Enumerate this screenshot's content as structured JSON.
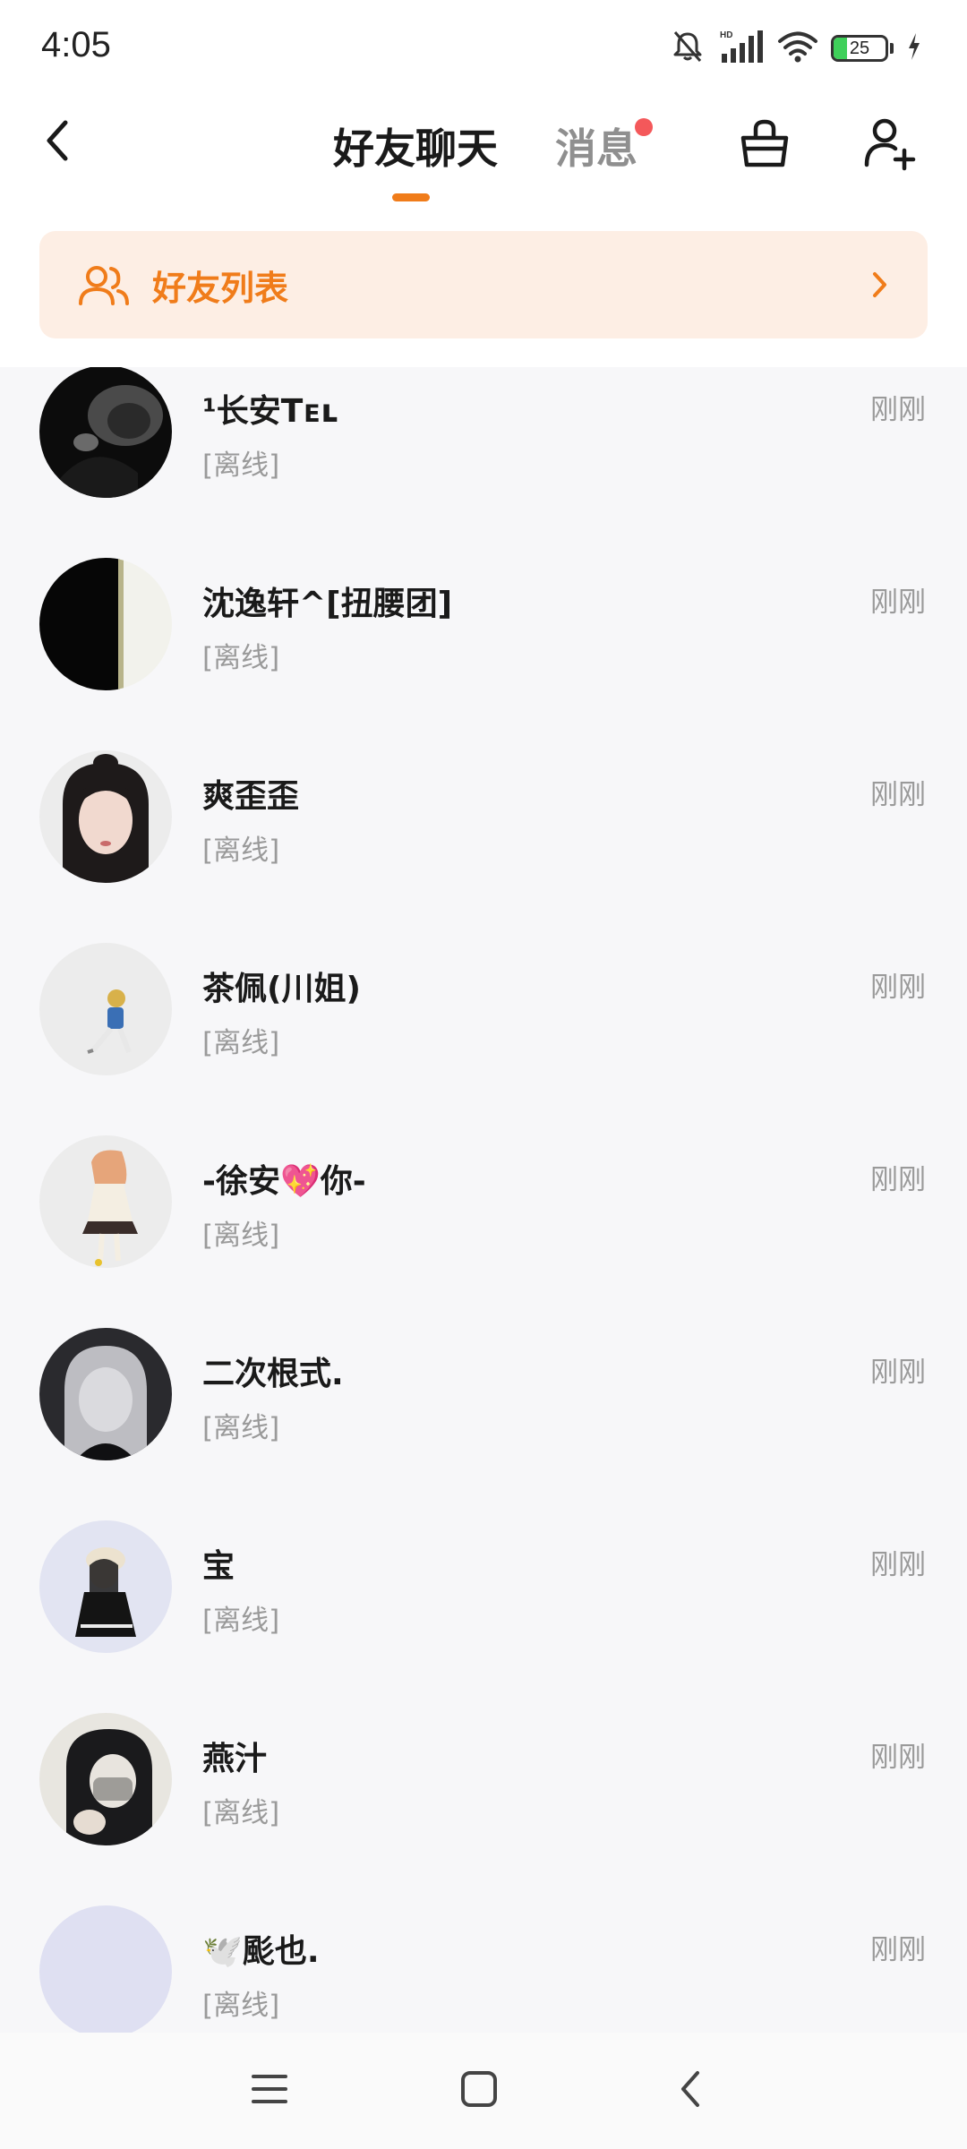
{
  "status_bar": {
    "time": "4:05",
    "battery_level": "25",
    "battery_fraction": 0.25,
    "icons": [
      "bell-mute-icon",
      "hd-icon",
      "signal-icon",
      "wifi-icon",
      "battery-icon",
      "charging-icon"
    ]
  },
  "header": {
    "back_icon": "chevron-left-icon",
    "tab_friends_chat": "好友聊天",
    "tab_messages": "消息",
    "messages_has_badge": true,
    "right_icons": [
      "basket-icon",
      "add-friend-icon"
    ]
  },
  "colors": {
    "accent": "#f07c1a",
    "banner_bg": "#fdeee4",
    "badge": "#f4585a",
    "list_bg": "#f7f7f9",
    "muted_text": "#9a9a9a"
  },
  "friends_banner": {
    "icon": "users-icon",
    "label": "好友列表",
    "chevron_icon": "chevron-right-icon"
  },
  "friends": [
    {
      "name": "¹长安Tᴇʟ",
      "status": "[离线]",
      "time": "刚刚"
    },
    {
      "name": "沈逸轩^[扭腰团]",
      "status": "[离线]",
      "time": "刚刚"
    },
    {
      "name": "爽歪歪",
      "status": "[离线]",
      "time": "刚刚"
    },
    {
      "name": "茶佩(川姐)",
      "status": "[离线]",
      "time": "刚刚"
    },
    {
      "name": "-徐安💖你-",
      "status": "[离线]",
      "time": "刚刚"
    },
    {
      "name": "二次根式.",
      "status": "[离线]",
      "time": "刚刚"
    },
    {
      "name": "宝",
      "status": "[离线]",
      "time": "刚刚"
    },
    {
      "name": "燕汁",
      "status": "[离线]",
      "time": "刚刚"
    },
    {
      "name": "🕊️颩也.",
      "status": "[离线]",
      "time": "刚刚"
    }
  ],
  "nav_bar": {
    "icons": [
      "menu-icon",
      "home-square-icon",
      "back-triangle-icon"
    ]
  }
}
